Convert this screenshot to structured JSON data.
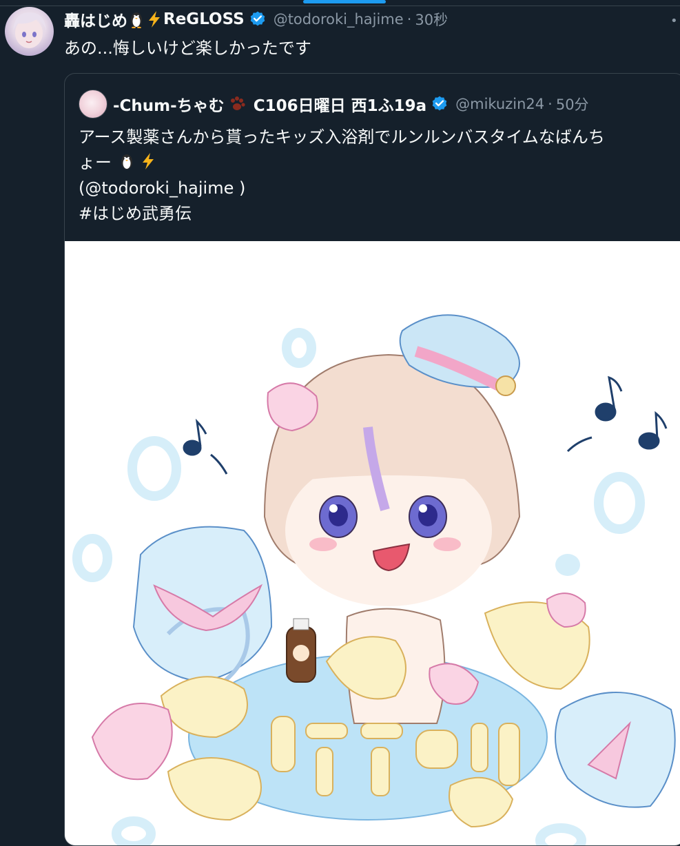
{
  "tweet": {
    "name": "轟はじめ",
    "name_emojis": [
      "penguin-emoji",
      "lightning-emoji"
    ],
    "name_suffix": "ReGLOSS",
    "handle": "@todoroki_hajime",
    "separator": "·",
    "time": "30秒",
    "text": "あの...悔しいけど楽しかったです",
    "more": "•"
  },
  "quote": {
    "name": "-Chum-ちゃむ",
    "name_suffix": "C106日曜日 西1ふ19a",
    "handle": "@mikuzin24",
    "separator": "·",
    "time": "50分",
    "text_line1": "アース製薬さんから貰ったキッズ入浴剤でルンルンバスタイムなばんち",
    "text_line2": "ょー",
    "mention_line": "(@todoroki_hajime )",
    "hashtag": "#はじめ武勇伝"
  },
  "colors": {
    "background": "#15202b",
    "text": "#f7f9f9",
    "secondary": "#8b98a5",
    "border": "#38444d",
    "accent": "#1d9bf0"
  }
}
